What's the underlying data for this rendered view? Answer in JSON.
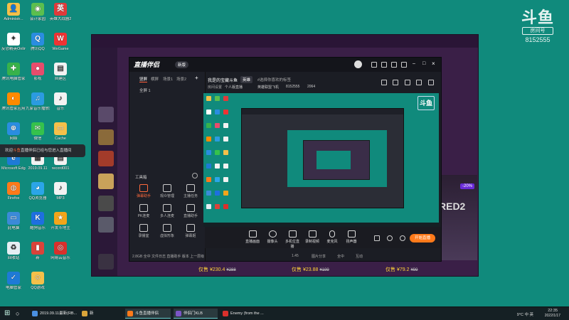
{
  "watermark": {
    "logo": "斗鱼",
    "room_label": "房间号",
    "room_number": "8152555"
  },
  "desktop_icons": [
    {
      "label": "Administr...",
      "color": "#f4c04a",
      "glyph": "👤"
    },
    {
      "label": "会计家园",
      "color": "#5bbf4e",
      "glyph": "◉"
    },
    {
      "label": "英雄大战器2",
      "color": "#e03a3a",
      "glyph": "英"
    },
    {
      "label": "反恐精英Online",
      "color": "#ffffff",
      "glyph": "✦"
    },
    {
      "label": "腾讯QQ",
      "color": "#2a8de0",
      "glyph": "Q"
    },
    {
      "label": "WeGame",
      "color": "#e33",
      "glyph": "W"
    },
    {
      "label": "腾讯电脑管家",
      "color": "#38b24a",
      "glyph": "✚"
    },
    {
      "label": "影视",
      "color": "#e74c6c",
      "glyph": "●"
    },
    {
      "label": "自建区",
      "color": "#f2f2f2",
      "glyph": "▤"
    },
    {
      "label": "腾讯管家应用",
      "color": "#ff8a00",
      "glyph": "◐"
    },
    {
      "label": "九家音乐播放器",
      "color": "#2b9be0",
      "glyph": "♫"
    },
    {
      "label": "音乐",
      "color": "#f2f2f2",
      "glyph": "♪"
    },
    {
      "label": "网络",
      "color": "#2a8de0",
      "glyph": "⊕"
    },
    {
      "label": "微信",
      "color": "#35c24c",
      "glyph": "✉"
    },
    {
      "label": "Cache",
      "color": "#f4c04a",
      "glyph": "▭"
    },
    {
      "label": "Microsoft Edge",
      "color": "#1e7ad6",
      "glyph": "e"
    },
    {
      "label": "2019.09.11",
      "color": "#f2f2f2",
      "glyph": "▦"
    },
    {
      "label": "record001",
      "color": "#f2f2f2",
      "glyph": "▤"
    },
    {
      "label": "Firefox",
      "color": "#ff7a1a",
      "glyph": "◍"
    },
    {
      "label": "QQ浏览器",
      "color": "#2ba5e8",
      "glyph": "◕"
    },
    {
      "label": "MP3",
      "color": "#f2f2f2",
      "glyph": "♪"
    },
    {
      "label": "此电脑",
      "color": "#3b8ad8",
      "glyph": "▭"
    },
    {
      "label": "酷狗音乐",
      "color": "#1e6fe0",
      "glyph": "K"
    },
    {
      "label": "开发斗地主",
      "color": "#f3a51a",
      "glyph": "★"
    },
    {
      "label": "回收站",
      "color": "#e5eef3",
      "glyph": "♻"
    },
    {
      "label": "新",
      "color": "#d9433a",
      "glyph": "▮"
    },
    {
      "label": "网易云音乐",
      "color": "#d9302c",
      "glyph": "◎"
    },
    {
      "label": "电脑管家",
      "color": "#1e7ad6",
      "glyph": "✓"
    },
    {
      "label": "QQ游戏",
      "color": "#f4c04a",
      "glyph": "☺"
    }
  ],
  "notice": {
    "prefix": "欢迎",
    "highlight": "斗鱼",
    "text": "直播伴侣已经与您进入直播间"
  },
  "app": {
    "brand": "直播伴侣",
    "version_pill": "新版",
    "side_tabs": [
      "竖屏",
      "横屏",
      "场景1",
      "场景2"
    ],
    "scene_item": "全屏 1",
    "tools_header": "工具箱",
    "tools": [
      {
        "label": "弹幕助手",
        "active": true
      },
      {
        "label": "观众管理",
        "active": false
      },
      {
        "label": "主播任务",
        "active": false
      },
      {
        "label": "PK连麦",
        "active": false
      },
      {
        "label": "多人连麦",
        "active": false
      },
      {
        "label": "直播助手",
        "active": false
      },
      {
        "label": "录播室",
        "active": false
      },
      {
        "label": "虚拟形象",
        "active": false
      },
      {
        "label": "弹幕姬",
        "active": false
      }
    ],
    "stream_title": "我是的宝藏斗鱼",
    "category": "英雄",
    "tag_prompt": "#选择你喜欢的标签",
    "room_label": "房间设置",
    "room_type": "个人版直播",
    "game_name": "英雄联盟飞机",
    "room_id": "8152555",
    "viewers": "2064",
    "bottom_buttons": [
      "直播画面",
      "摄像头",
      "多机位直播",
      "录制视频",
      "麦克风",
      "扬声器"
    ],
    "start_button": "开始直播",
    "footer": [
      "1.45",
      "图片分享",
      "全中",
      "互动"
    ],
    "footer_left": "2.8GB 全中 文件日志 直播助手 版本 上一层级"
  },
  "store": {
    "banner_text": "RED2",
    "discount": "-20%",
    "prices": [
      {
        "now": "仅售 ¥230.4",
        "was": "¥288"
      },
      {
        "now": "仅售 ¥23.88",
        "was": "¥199"
      },
      {
        "now": "仅售 ¥79.2",
        "was": "¥99"
      }
    ]
  },
  "taskbar": {
    "items": [
      {
        "label": "2019.09.11最新(RB...",
        "color": "#4a90e2",
        "active": false
      },
      {
        "label": "新",
        "color": "#d9a43a",
        "active": false
      },
      {
        "label": "斗鱼直播伴侣",
        "color": "#ff7a1a",
        "active": true
      },
      {
        "label": "伴侣门KLB",
        "color": "#7b55c6",
        "active": true
      },
      {
        "label": "Enemy (from the ...",
        "color": "#d9302c",
        "active": false
      }
    ],
    "tray_text": "9°C 中 英",
    "time": "22:35",
    "date": "2022/1/17"
  }
}
